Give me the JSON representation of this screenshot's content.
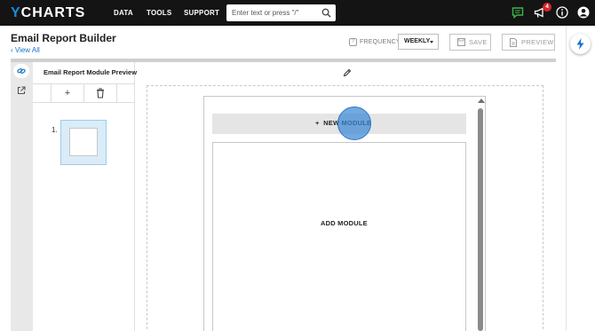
{
  "topnav": {
    "logo_y": "Y",
    "logo_rest": "CHARTS",
    "links": [
      "DATA",
      "TOOLS",
      "SUPPORT"
    ],
    "search_placeholder": "Enter text or press \"/\"",
    "notification_count": "4",
    "icons": [
      "chat-icon",
      "megaphone-icon",
      "info-icon",
      "user-icon"
    ],
    "accent_color": "#1a8ce0",
    "chat_color": "#3cb44b",
    "badge_color": "#d9252b"
  },
  "header": {
    "title": "Email Report Builder",
    "back_link": "View All",
    "frequency_label": "FREQUENCY:",
    "frequency_value": "WEEKLY",
    "save_label": "SAVE",
    "preview_label": "PREVIEW"
  },
  "preview_panel": {
    "title": "Email Report Module Preview",
    "add_symbol": "+",
    "items": [
      {
        "number": "1."
      }
    ]
  },
  "editor": {
    "new_module_label": "NEW MODULE",
    "new_module_symbol": "+",
    "add_module_label": "ADD MODULE"
  }
}
